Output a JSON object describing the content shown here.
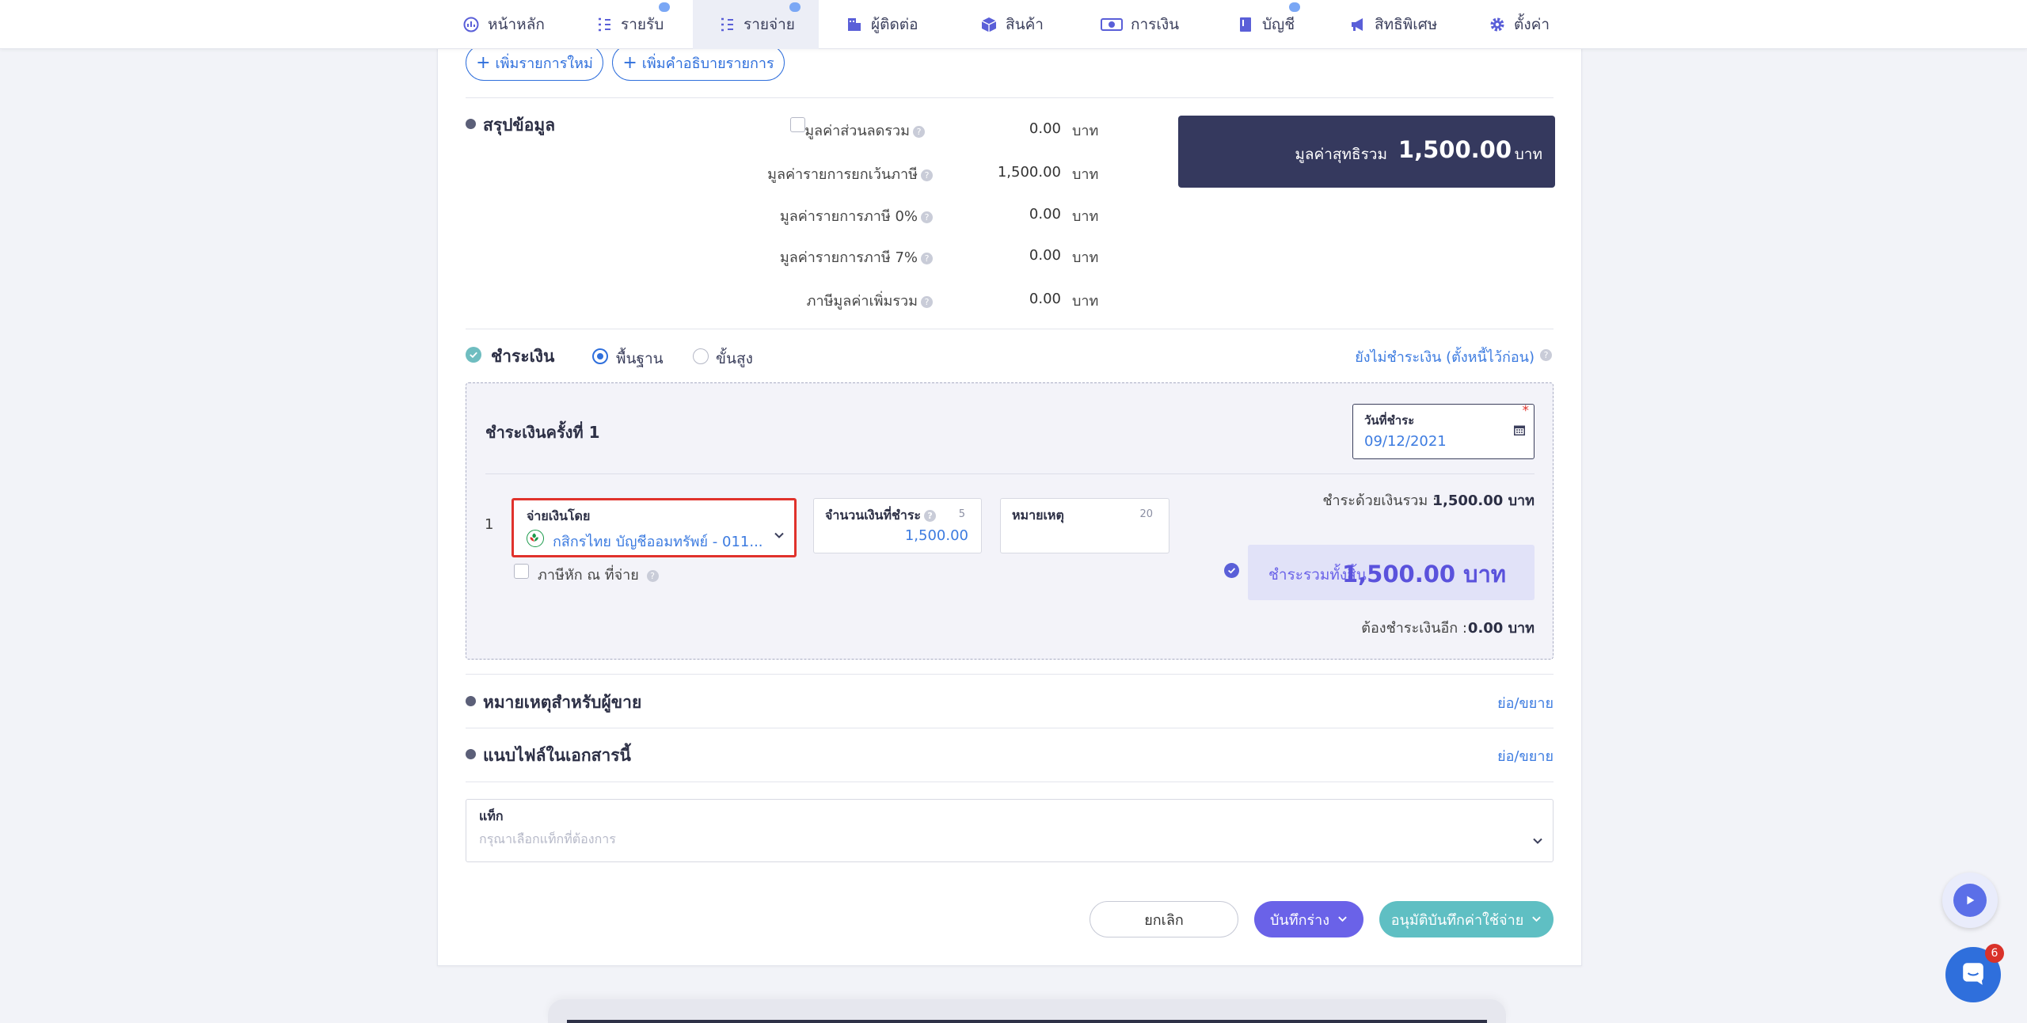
{
  "nav": {
    "items": [
      {
        "label": "หน้าหลัก",
        "icon": "dashboard-icon"
      },
      {
        "label": "รายรับ",
        "icon": "income-icon"
      },
      {
        "label": "รายจ่าย",
        "icon": "expense-icon"
      },
      {
        "label": "ผู้ติดต่อ",
        "icon": "contacts-icon"
      },
      {
        "label": "สินค้า",
        "icon": "box-icon"
      },
      {
        "label": "การเงิน",
        "icon": "money-icon"
      },
      {
        "label": "บัญชี",
        "icon": "ledger-icon"
      },
      {
        "label": "สิทธิพิเศษ",
        "icon": "megaphone-icon"
      },
      {
        "label": "ตั้งค่า",
        "icon": "gear-icon"
      }
    ]
  },
  "actions": {
    "add_item": "เพิ่มรายการใหม่",
    "add_description": "เพิ่มคำอธิบายรายการ"
  },
  "summary": {
    "title": "สรุปข้อมูล",
    "rows": [
      {
        "label": "มูลค่าส่วนลดรวม",
        "value": "0.00",
        "unit": "บาท"
      },
      {
        "label": "มูลค่ารายการยกเว้นภาษี",
        "value": "1,500.00",
        "unit": "บาท"
      },
      {
        "label": "มูลค่ารายการภาษี 0%",
        "value": "0.00",
        "unit": "บาท"
      },
      {
        "label": "มูลค่ารายการภาษี 7%",
        "value": "0.00",
        "unit": "บาท"
      },
      {
        "label": "ภาษีมูลค่าเพิ่มรวม",
        "value": "0.00",
        "unit": "บาท"
      }
    ],
    "net_label": "มูลค่าสุทธิรวม",
    "net_value": "1,500.00",
    "net_unit": "บาท"
  },
  "payment": {
    "title": "ชำระเงิน",
    "mode_basic": "พื้นฐาน",
    "mode_advanced": "ขั้นสูง",
    "unpaid_link": "ยังไม่ชำระเงิน (ตั้งหนี้ไว้ก่อน)",
    "round_title": "ชำระเงินครั้งที่ 1",
    "date_label": "วันที่ชำระ",
    "date_value": "09/12/2021",
    "required_mark": "*",
    "row_index": "1",
    "paid_by_label": "จ่ายเงินโดย",
    "paid_by_value": "กสิกรไทย บัญชีออมทรัพย์ - 011...",
    "amount_label": "จำนวนเงินที่ชำระ",
    "amount_counter": "5",
    "amount_value": "1,500.00",
    "note_label": "หมายเหตุ",
    "note_counter": "20",
    "withholding_label": "ภาษีหัก ณ ที่จ่าย",
    "paid_total_label": "ชำระด้วยเงินรวม :",
    "paid_total_value": "1,500.00 บาท",
    "grand_label": "ชำระรวมทั้งสิ้น",
    "grand_value": "1,500.00 บาท",
    "remaining_label": "ต้องชำระเงินอีก :",
    "remaining_value": "0.00 บาท"
  },
  "sections": {
    "seller_note": "หมายเหตุสำหรับผู้ขาย",
    "attach": "แนบไฟล์ในเอกสารนี้",
    "toggle": "ย่อ/ขยาย"
  },
  "tags": {
    "label": "แท็ก",
    "placeholder": "กรุณาเลือกแท็กที่ต้องการ"
  },
  "footer": {
    "cancel": "ยกเลิก",
    "save_draft": "บันทึกร่าง",
    "approve": "อนุมัติบันทึกค่าใช้จ่าย"
  },
  "chat": {
    "badge": "6"
  },
  "colors": {
    "brand": "#2f6fdc",
    "navy": "#35395e",
    "purple": "#6a62e8",
    "teal": "#5fbfc3",
    "kbank_green": "#1a9a4a",
    "highlight_red": "#e0322c"
  }
}
